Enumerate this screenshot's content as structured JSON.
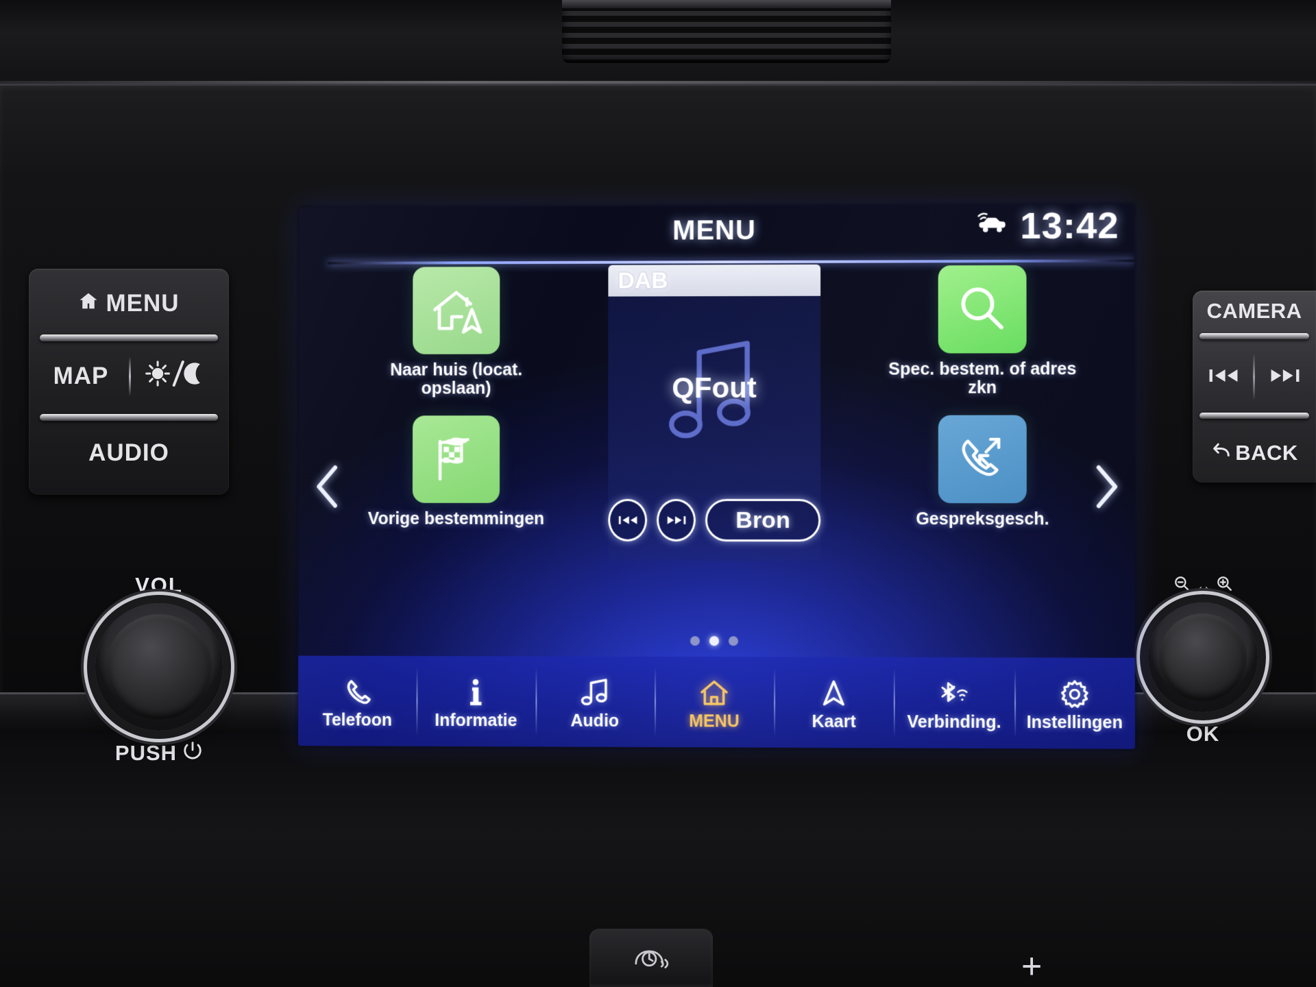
{
  "screen": {
    "header": {
      "title": "MENU",
      "clock": "13:42",
      "status_icon": "car-connected-icon"
    },
    "nav_arrows": {
      "left": "chevron-left-icon",
      "right": "chevron-right-icon"
    },
    "tiles_left": [
      {
        "label": "Naar huis (locat. opslaan)",
        "icon": "home-navigate-icon",
        "color": "#a9e096"
      },
      {
        "label": "Vorige bestemmingen",
        "icon": "checkered-flag-icon",
        "color": "#9ade85"
      }
    ],
    "tiles_right": [
      {
        "label": "Spec. bestem. of adres zkn",
        "icon": "magnifier-icon",
        "color": "#7ee86c"
      },
      {
        "label": "Gespreksgesch.",
        "icon": "call-history-icon",
        "color": "#559ccd"
      }
    ],
    "media": {
      "source": "DAB",
      "station": "QFout",
      "prev_label": "previous-track-icon",
      "next_label": "next-track-icon",
      "source_button": "Bron"
    },
    "page_dots": {
      "count": 3,
      "active_index": 1
    },
    "nav_bar": [
      {
        "label": "Telefoon",
        "icon": "phone-icon",
        "active": false
      },
      {
        "label": "Informatie",
        "icon": "info-icon",
        "active": false
      },
      {
        "label": "Audio",
        "icon": "music-note-icon",
        "active": false
      },
      {
        "label": "MENU",
        "icon": "home-icon",
        "active": true
      },
      {
        "label": "Kaart",
        "icon": "navigation-arrow-icon",
        "active": false
      },
      {
        "label": "Verbinding.",
        "icon": "bluetooth-wifi-icon",
        "active": false
      },
      {
        "label": "Instellingen",
        "icon": "gear-icon",
        "active": false
      }
    ]
  },
  "hardware": {
    "left_buttons": {
      "menu": "MENU",
      "menu_icon": "home-icon",
      "map": "MAP",
      "daynight_icon": "sun-moon-icon",
      "audio": "AUDIO"
    },
    "right_buttons": {
      "camera": "CAMERA",
      "prev_icon": "previous-track-icon",
      "next_icon": "next-track-icon",
      "back": "BACK",
      "back_icon": "back-arrow-icon"
    },
    "volume_knob": {
      "label": "VOL",
      "sub": "PUSH",
      "power_icon": "power-icon"
    },
    "ok_knob": {
      "label": "OK",
      "zoom_out_icon": "zoom-out-icon",
      "zoom_in_icon": "zoom-in-icon"
    },
    "climate": {
      "icon": "defrost-icon",
      "plus": "+"
    }
  }
}
